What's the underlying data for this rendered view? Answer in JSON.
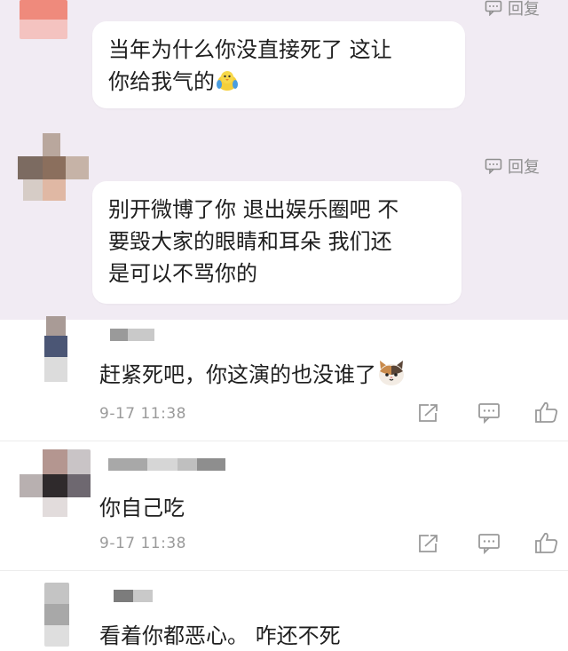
{
  "thread": {
    "reply_label": "回复",
    "replies": [
      {
        "text_lines": [
          "当年为什么你没直接死了 这让",
          "你给我气的"
        ],
        "emoji": "chick-emoji"
      },
      {
        "text_lines": [
          "别开微博了你 退出娱乐圈吧 不",
          "要毁大家的眼睛和耳朵 我们还",
          "是可以不骂你的"
        ]
      }
    ]
  },
  "comments": [
    {
      "text": "赶紧死吧，你这演的也没谁了",
      "emoji": "cat-emoji",
      "time": "9-17 11:38"
    },
    {
      "text": "你自己吃",
      "time": "9-17 11:38"
    },
    {
      "text": "看着你都恶心。 咋还不死"
    }
  ],
  "icons": {
    "reply": "comment-bubble-icon",
    "share": "share-icon",
    "comment": "comment-icon",
    "like": "thumbs-up-icon"
  },
  "colors": {
    "thread_background": "#f1ebf3",
    "bubble": "#ffffff",
    "muted_text": "#9a9a9a"
  }
}
